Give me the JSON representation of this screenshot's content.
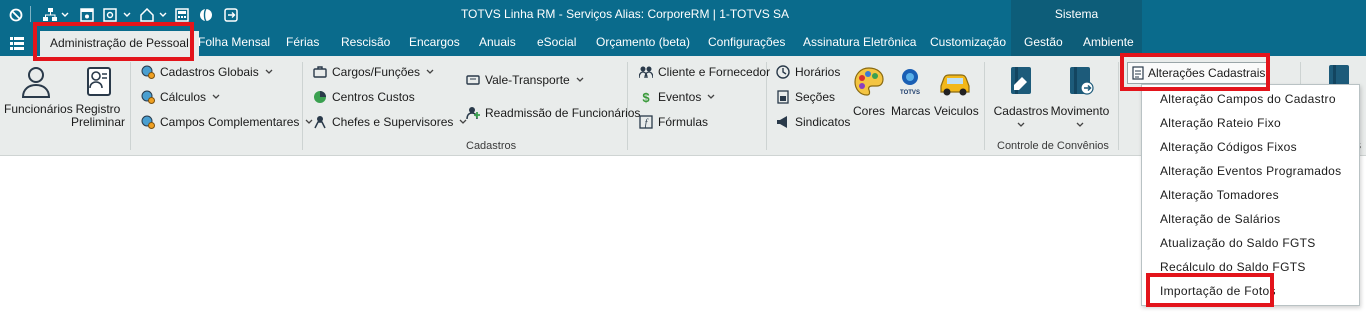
{
  "window": {
    "title": "TOTVS Linha RM - Serviços  Alias: CorporeRM | 1-TOTVS SA",
    "context_group": "Sistema"
  },
  "tabs": [
    {
      "id": "administracao",
      "label": "Administração de Pessoal",
      "active": true
    },
    {
      "id": "folha",
      "label": "Folha Mensal"
    },
    {
      "id": "ferias",
      "label": "Férias"
    },
    {
      "id": "rescisao",
      "label": "Rescisão"
    },
    {
      "id": "encargos",
      "label": "Encargos"
    },
    {
      "id": "anuais",
      "label": "Anuais"
    },
    {
      "id": "esocial",
      "label": "eSocial"
    },
    {
      "id": "orcamento",
      "label": "Orçamento (beta)"
    },
    {
      "id": "configuracoes",
      "label": "Configurações"
    },
    {
      "id": "assinatura",
      "label": "Assinatura Eletrônica"
    },
    {
      "id": "customizacao",
      "label": "Customização"
    },
    {
      "id": "gestao",
      "label": "Gestão"
    },
    {
      "id": "ambiente",
      "label": "Ambiente"
    }
  ],
  "ribbon": {
    "funcionarios": "Funcionários",
    "registro_preliminar_l1": "Registro",
    "registro_preliminar_l2": "Preliminar",
    "cadastros_globais": "Cadastros Globais",
    "calculos": "Cálculos",
    "campos_complementares": "Campos Complementares",
    "cargos_funcoes": "Cargos/Funções",
    "centros_custos": "Centros Custos",
    "chefes_supervisores": "Chefes e Supervisores",
    "vale_transporte": "Vale-Transporte",
    "readmissao": "Readmissão de Funcionários",
    "cliente_fornecedor": "Cliente e Fornecedor",
    "eventos": "Eventos",
    "formulas": "Fórmulas",
    "horarios": "Horários",
    "secoes": "Seções",
    "sindicatos": "Sindicatos",
    "cores": "Cores",
    "marcas": "Marcas",
    "veiculos": "Veiculos",
    "marcas_logo_text": "TOTVS",
    "cadastros_group_label": "Cadastros",
    "conv_cadastros": "Cadastros",
    "conv_movimento": "Movimento",
    "convenios_group_label": "Controle de Convênios",
    "alteracoes_cadastrais": "Alterações Cadastrais",
    "right_fragment": "s"
  },
  "dropdown": {
    "items": [
      "Alteração Campos do Cadastro",
      "Alteração Rateio Fixo",
      "Alteração Códigos Fixos",
      "Alteração Eventos Programados",
      "Alteração Tomadores",
      "Alteração de Salários",
      "Atualização do Saldo FGTS",
      "Recálculo do Saldo FGTS",
      "Importação de Fotos"
    ]
  },
  "colors": {
    "titlebar": "#0a6b8c",
    "context_group": "#0d5d79",
    "ribbon_bg": "#e9eceb",
    "highlight": "#e3141b"
  }
}
